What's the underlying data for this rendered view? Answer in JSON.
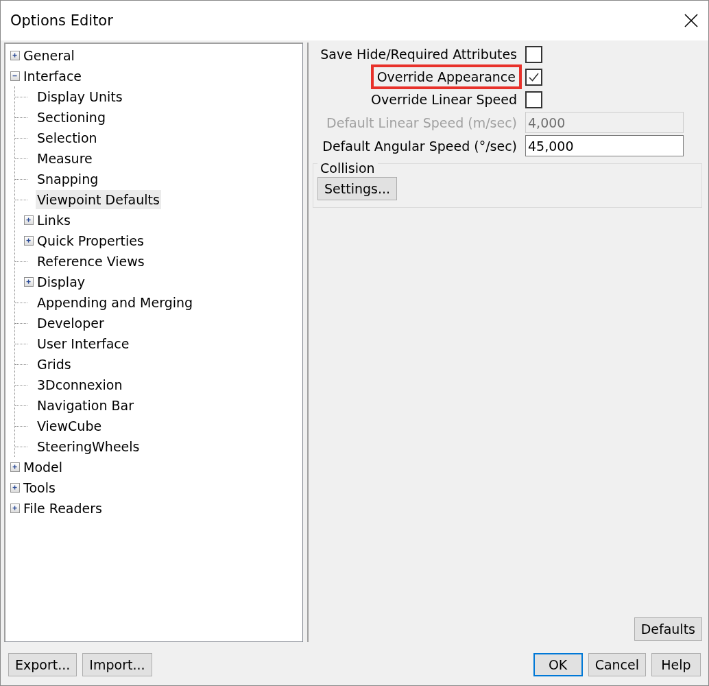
{
  "window": {
    "title": "Options Editor"
  },
  "tree": [
    {
      "label": "General",
      "expanded": false,
      "selected": false
    },
    {
      "label": "Interface",
      "expanded": true,
      "selected": false,
      "children": [
        {
          "label": "Display Units",
          "selected": false
        },
        {
          "label": "Sectioning",
          "selected": false
        },
        {
          "label": "Selection",
          "selected": false
        },
        {
          "label": "Measure",
          "selected": false
        },
        {
          "label": "Snapping",
          "selected": false
        },
        {
          "label": "Viewpoint Defaults",
          "selected": true
        },
        {
          "label": "Links",
          "expanded": false,
          "selected": false
        },
        {
          "label": "Quick Properties",
          "expanded": false,
          "selected": false
        },
        {
          "label": "Reference Views",
          "selected": false
        },
        {
          "label": "Display",
          "expanded": false,
          "selected": false
        },
        {
          "label": "Appending and Merging",
          "selected": false
        },
        {
          "label": "Developer",
          "selected": false
        },
        {
          "label": "User Interface",
          "selected": false
        },
        {
          "label": "Grids",
          "selected": false
        },
        {
          "label": "3Dconnexion",
          "selected": false
        },
        {
          "label": "Navigation Bar",
          "selected": false
        },
        {
          "label": "ViewCube",
          "selected": false
        },
        {
          "label": "SteeringWheels",
          "selected": false
        }
      ]
    },
    {
      "label": "Model",
      "expanded": false,
      "selected": false
    },
    {
      "label": "Tools",
      "expanded": false,
      "selected": false
    },
    {
      "label": "File Readers",
      "expanded": false,
      "selected": false
    }
  ],
  "options": [
    {
      "kind": "checkbox",
      "label": "Save Hide/Required Attributes",
      "checked": false,
      "highlighted": false
    },
    {
      "kind": "checkbox",
      "label": "Override Appearance",
      "checked": true,
      "highlighted": true
    },
    {
      "kind": "checkbox",
      "label": "Override Linear Speed",
      "checked": false,
      "highlighted": false
    },
    {
      "kind": "number",
      "label": "Default Linear Speed (m/sec)",
      "value": "4,000",
      "disabled": true
    },
    {
      "kind": "number",
      "label": "Default Angular Speed (°/sec)",
      "value": "45,000",
      "disabled": false
    }
  ],
  "collision": {
    "title": "Collision",
    "button": "Settings..."
  },
  "panel_button": "Defaults",
  "footer_left": [
    {
      "label": "Export...",
      "default": false
    },
    {
      "label": "Import...",
      "default": false
    }
  ],
  "footer_right": [
    {
      "label": "OK",
      "default": true
    },
    {
      "label": "Cancel",
      "default": false
    },
    {
      "label": "Help",
      "default": false
    }
  ]
}
